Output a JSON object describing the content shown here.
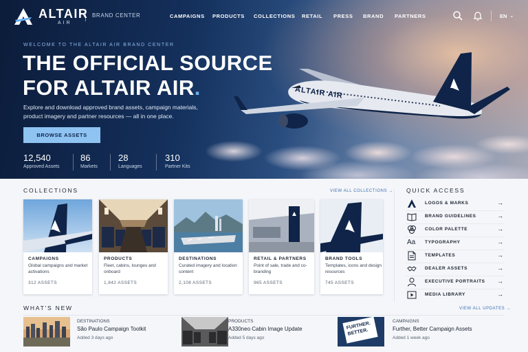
{
  "nav": {
    "brand_name": "ALTAIR",
    "brand_sub": "AIR",
    "brand_center": "BRAND CENTER",
    "links": [
      "CAMPAIGNS",
      "PRODUCTS",
      "COLLECTIONS",
      "RETAIL",
      "PRESS",
      "BRAND",
      "PARTNERS"
    ],
    "language": "EN",
    "icons": [
      "search-icon",
      "bell-icon",
      "chevron-down-icon"
    ]
  },
  "hero": {
    "eyebrow": "WELCOME TO THE ALTAIR AIR BRAND CENTER",
    "headline_line1": "THE OFFICIAL SOURCE",
    "headline_line2": "FOR ALTAIR AIR",
    "headline_dot": ".",
    "description": "Explore and download approved brand assets, campaign materials, product imagery and partner resources — all in one place.",
    "cta": "BROWSE ASSETS",
    "plane_livery": "ALTAIR AIR",
    "stats": [
      {
        "value": "12,540",
        "label": "Approved Assets"
      },
      {
        "value": "86",
        "label": "Markets"
      },
      {
        "value": "28",
        "label": "Languages"
      },
      {
        "value": "310",
        "label": "Partner Kits"
      }
    ]
  },
  "collections": {
    "title": "COLLECTIONS",
    "view_all": "VIEW ALL COLLECTIONS →",
    "cards": [
      {
        "title": "CAMPAIGNS",
        "desc": "Global campaigns and market activations",
        "count": "312 ASSETS"
      },
      {
        "title": "PRODUCTS",
        "desc": "Fleet, cabins, lounges and onboard",
        "count": "1,842 ASSETS"
      },
      {
        "title": "DESTINATIONS",
        "desc": "Curated imagery and location content",
        "count": "2,108 ASSETS"
      },
      {
        "title": "RETAIL & PARTNERS",
        "desc": "Point of sale, trade and co-branding",
        "count": "965 ASSETS"
      },
      {
        "title": "BRAND TOOLS",
        "desc": "Templates, icons and design resources",
        "count": "745 ASSETS"
      }
    ]
  },
  "quick_access": {
    "title": "QUICK ACCESS",
    "items": [
      {
        "label": "LOGOS & MARKS",
        "icon": "logo-icon"
      },
      {
        "label": "BRAND GUIDELINES",
        "icon": "book-icon"
      },
      {
        "label": "COLOR PALETTE",
        "icon": "palette-icon"
      },
      {
        "label": "TYPOGRAPHY",
        "icon": "typography-icon",
        "glyph": "Aa"
      },
      {
        "label": "TEMPLATES",
        "icon": "template-icon"
      },
      {
        "label": "DEALER ASSETS",
        "icon": "handshake-icon"
      },
      {
        "label": "EXECUTIVE PORTRAITS",
        "icon": "person-icon"
      },
      {
        "label": "MEDIA LIBRARY",
        "icon": "play-icon"
      }
    ],
    "arrow": "→"
  },
  "whats_new": {
    "title": "WHAT'S NEW",
    "view_all": "VIEW ALL UPDATES →",
    "items": [
      {
        "category": "DESTINATIONS",
        "title": "São Paulo Campaign Toolkit",
        "date": "Added 3 days ago"
      },
      {
        "category": "PRODUCTS",
        "title": "A330neo Cabin Image Update",
        "date": "Added 5 days ago"
      },
      {
        "category": "CAMPAIGNS",
        "title": "Further, Better Campaign Assets",
        "date": "Added 1 week ago",
        "thumb_text": "FURTHER. BETTER."
      }
    ]
  },
  "colors": {
    "navy": "#0f2448",
    "accent": "#8ec3f2",
    "link": "#3d6fb2"
  }
}
